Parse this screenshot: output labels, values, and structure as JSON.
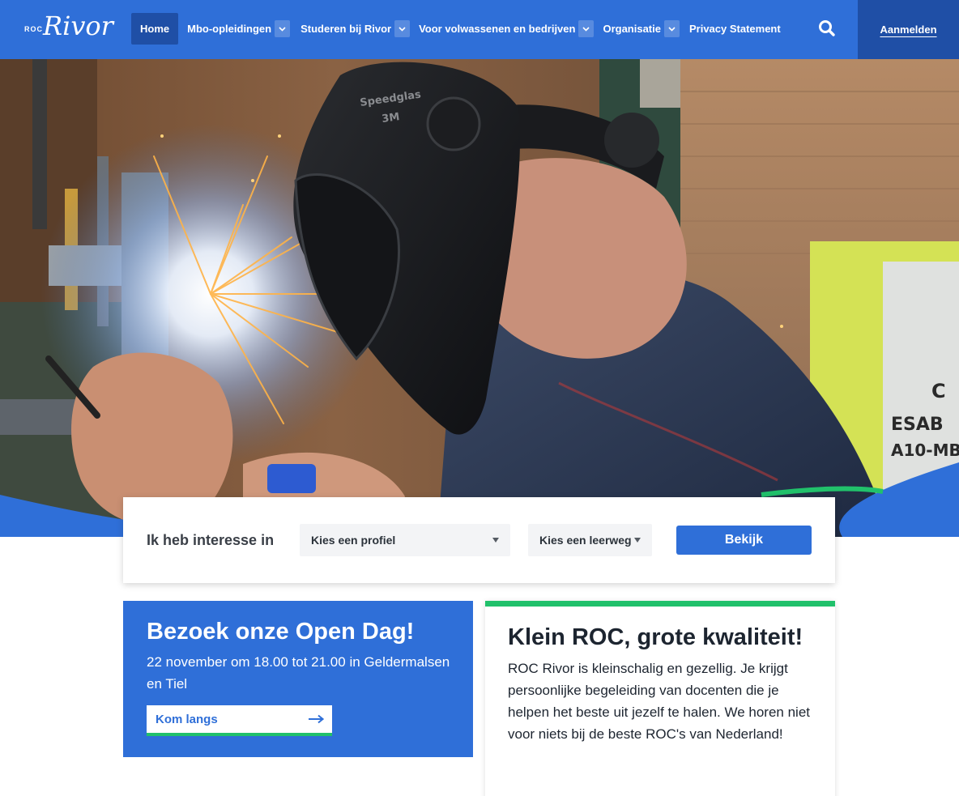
{
  "brand": {
    "prefix": "ROC",
    "name": "Rivor"
  },
  "nav": {
    "items": [
      {
        "label": "Home",
        "active": true,
        "dropdown": false
      },
      {
        "label": "Mbo-opleidingen",
        "active": false,
        "dropdown": true
      },
      {
        "label": "Studeren bij Rivor",
        "active": false,
        "dropdown": true
      },
      {
        "label": "Voor volwassenen en bedrijven",
        "active": false,
        "dropdown": true
      },
      {
        "label": "Organisatie",
        "active": false,
        "dropdown": true
      },
      {
        "label": "Privacy Statement",
        "active": false,
        "dropdown": false
      }
    ],
    "search_icon": "search-icon",
    "login_label": "Aanmelden"
  },
  "filter": {
    "label": "Ik heb interesse in",
    "profile_select": "Kies een profiel",
    "leerweg_select": "Kies een leerweg",
    "submit_label": "Bekijk"
  },
  "openday": {
    "title": "Bezoek onze Open Dag!",
    "subtitle": "22 november om 18.00 tot 21.00 in Geldermalsen en Tiel",
    "cta_label": "Kom langs"
  },
  "quality": {
    "title": "Klein ROC, grote kwaliteit!",
    "body": "ROC Rivor is kleinschalig en gezellig. Je krijgt persoonlijke begeleiding van docenten die je helpen het beste uit jezelf te halen. We horen niet voor niets bij de beste ROC's van Nederland!"
  },
  "colors": {
    "primary": "#2f6fd8",
    "primary_dark": "#1f4fa6",
    "accent_green": "#21c16b",
    "text": "#1d2530"
  }
}
